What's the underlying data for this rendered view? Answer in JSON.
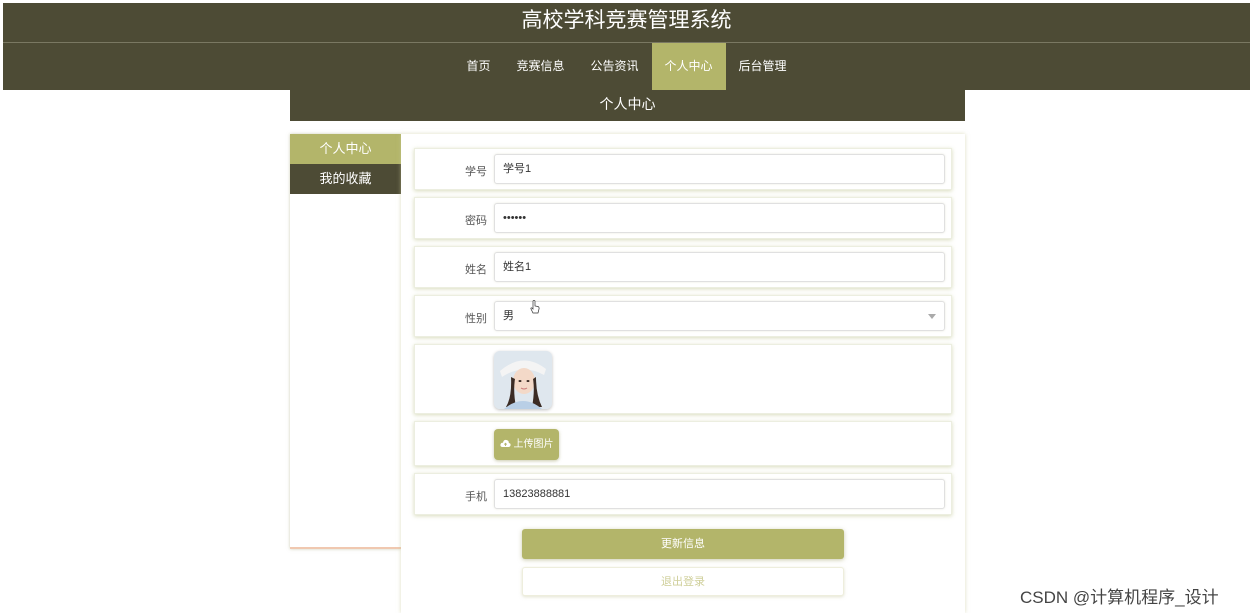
{
  "app": {
    "title": "高校学科竞赛管理系统"
  },
  "nav": {
    "items": [
      {
        "label": "首页",
        "active": false
      },
      {
        "label": "竞赛信息",
        "active": false
      },
      {
        "label": "公告资讯",
        "active": false
      },
      {
        "label": "个人中心",
        "active": true
      },
      {
        "label": "后台管理",
        "active": false
      }
    ]
  },
  "banner": {
    "title": "个人中心"
  },
  "sidebar": {
    "items": [
      {
        "label": "个人中心",
        "active": true
      },
      {
        "label": "我的收藏",
        "active": false
      }
    ]
  },
  "form": {
    "student_id": {
      "label": "学号",
      "value": "学号1"
    },
    "password": {
      "label": "密码",
      "value": "••••••"
    },
    "name": {
      "label": "姓名",
      "value": "姓名1"
    },
    "gender": {
      "label": "性别",
      "value": "男"
    },
    "upload_label": "上传图片",
    "phone": {
      "label": "手机",
      "value": "13823888881"
    }
  },
  "buttons": {
    "update": "更新信息",
    "logout": "退出登录"
  },
  "watermark": "CSDN @计算机程序_设计",
  "colors": {
    "header_bg": "#4d4b35",
    "accent": "#b3b56a"
  }
}
